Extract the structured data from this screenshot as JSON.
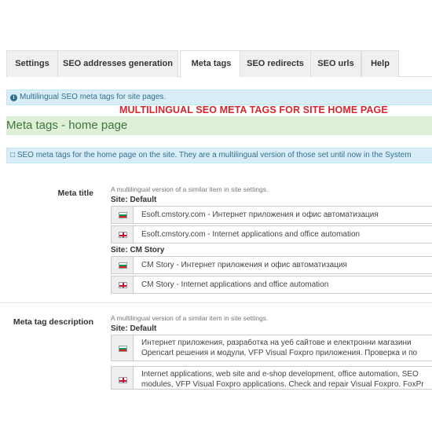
{
  "tabs": [
    {
      "label": "Settings"
    },
    {
      "label": "SEO addresses generation"
    },
    {
      "label": "Meta tags"
    },
    {
      "label": "SEO redirects"
    },
    {
      "label": "SEO urls"
    },
    {
      "label": "Help"
    }
  ],
  "info": {
    "text": "Multilingual SEO meta tags for site pages."
  },
  "overlay_title": "MULTILINGUAL SEO META TAGS FOR SITE HOME PAGE",
  "heading": "Meta tags - home page",
  "description": "SEO meta tags for the home page on the site. They are a multilingual version of those set until now in the System",
  "meta_title": {
    "label": "Meta title",
    "hint": "A multilingual version of a similar item in site settings.",
    "groups": [
      {
        "site": "Site: Default",
        "rows": [
          {
            "text": "Esoft.cmstory.com - Интернет приложения и офис автоматизация"
          },
          {
            "text": "Esoft.cmstory.com - Internet applications and office automation"
          }
        ]
      },
      {
        "site": "Site: CM Story",
        "rows": [
          {
            "text": "CM Story - Интернет приложения и офис автоматизация"
          },
          {
            "text": "CM Story - Internet applications and office automation"
          }
        ]
      }
    ]
  },
  "meta_description": {
    "label": "Meta tag description",
    "hint": "A multilingual version of a similar item in site settings.",
    "site": "Site: Default",
    "rows": [
      {
        "line1": "Интернет приложения, разработка на уеб сайтове  и електронни магазини",
        "line2": "Opencart решения и модули, VFP Visual Foxpro приложения. Проверка и по"
      },
      {
        "line1": "Internet applications, web site and e-shop development, office automation, SEO",
        "line2": "modules, VFP Visual Foxpro applications. Check and repair Visual Foxpro. FoxPr"
      }
    ]
  },
  "colors": {
    "info_bg": "#d9edf7",
    "success_bg": "#dff0d8",
    "overlay_red": "#d6262e"
  }
}
